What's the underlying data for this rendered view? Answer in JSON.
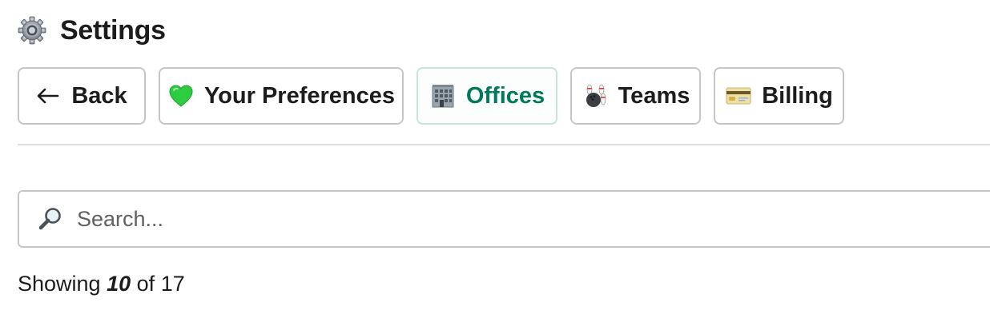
{
  "header": {
    "title": "Settings",
    "icon": "gear-icon"
  },
  "tabs": [
    {
      "id": "back",
      "label": "Back",
      "icon": "arrow-left-icon",
      "active": false
    },
    {
      "id": "preferences",
      "label": "Your Preferences",
      "icon": "green-heart-icon",
      "active": false
    },
    {
      "id": "offices",
      "label": "Offices",
      "icon": "office-building-icon",
      "active": true
    },
    {
      "id": "teams",
      "label": "Teams",
      "icon": "bowling-icon",
      "active": false
    },
    {
      "id": "billing",
      "label": "Billing",
      "icon": "credit-card-icon",
      "active": false
    }
  ],
  "search": {
    "placeholder": "Search...",
    "value": "",
    "icon": "magnifying-glass-icon"
  },
  "status": {
    "prefix": "Showing",
    "shown": "10",
    "middle": "of",
    "total": "17"
  },
  "colors": {
    "active_tab_text": "#007a5a",
    "active_tab_border": "#c7e4dc",
    "border": "#c6c6c6",
    "text": "#1d1c1d"
  }
}
